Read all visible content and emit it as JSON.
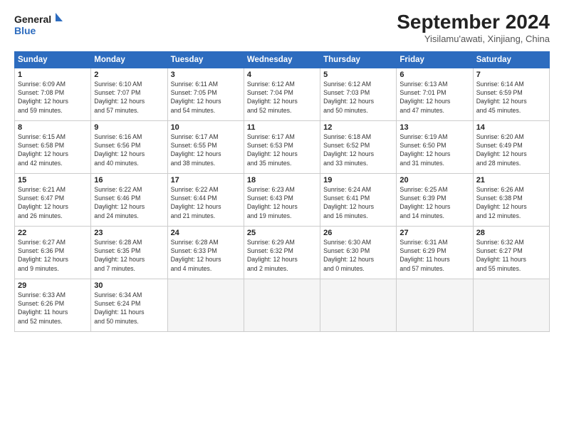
{
  "logo": {
    "line1": "General",
    "line2": "Blue"
  },
  "title": "September 2024",
  "location": "Yisilamu'awati, Xinjiang, China",
  "days_of_week": [
    "Sunday",
    "Monday",
    "Tuesday",
    "Wednesday",
    "Thursday",
    "Friday",
    "Saturday"
  ],
  "weeks": [
    [
      {
        "day": "1",
        "info": "Sunrise: 6:09 AM\nSunset: 7:08 PM\nDaylight: 12 hours\nand 59 minutes."
      },
      {
        "day": "2",
        "info": "Sunrise: 6:10 AM\nSunset: 7:07 PM\nDaylight: 12 hours\nand 57 minutes."
      },
      {
        "day": "3",
        "info": "Sunrise: 6:11 AM\nSunset: 7:05 PM\nDaylight: 12 hours\nand 54 minutes."
      },
      {
        "day": "4",
        "info": "Sunrise: 6:12 AM\nSunset: 7:04 PM\nDaylight: 12 hours\nand 52 minutes."
      },
      {
        "day": "5",
        "info": "Sunrise: 6:12 AM\nSunset: 7:03 PM\nDaylight: 12 hours\nand 50 minutes."
      },
      {
        "day": "6",
        "info": "Sunrise: 6:13 AM\nSunset: 7:01 PM\nDaylight: 12 hours\nand 47 minutes."
      },
      {
        "day": "7",
        "info": "Sunrise: 6:14 AM\nSunset: 6:59 PM\nDaylight: 12 hours\nand 45 minutes."
      }
    ],
    [
      {
        "day": "8",
        "info": "Sunrise: 6:15 AM\nSunset: 6:58 PM\nDaylight: 12 hours\nand 42 minutes."
      },
      {
        "day": "9",
        "info": "Sunrise: 6:16 AM\nSunset: 6:56 PM\nDaylight: 12 hours\nand 40 minutes."
      },
      {
        "day": "10",
        "info": "Sunrise: 6:17 AM\nSunset: 6:55 PM\nDaylight: 12 hours\nand 38 minutes."
      },
      {
        "day": "11",
        "info": "Sunrise: 6:17 AM\nSunset: 6:53 PM\nDaylight: 12 hours\nand 35 minutes."
      },
      {
        "day": "12",
        "info": "Sunrise: 6:18 AM\nSunset: 6:52 PM\nDaylight: 12 hours\nand 33 minutes."
      },
      {
        "day": "13",
        "info": "Sunrise: 6:19 AM\nSunset: 6:50 PM\nDaylight: 12 hours\nand 31 minutes."
      },
      {
        "day": "14",
        "info": "Sunrise: 6:20 AM\nSunset: 6:49 PM\nDaylight: 12 hours\nand 28 minutes."
      }
    ],
    [
      {
        "day": "15",
        "info": "Sunrise: 6:21 AM\nSunset: 6:47 PM\nDaylight: 12 hours\nand 26 minutes."
      },
      {
        "day": "16",
        "info": "Sunrise: 6:22 AM\nSunset: 6:46 PM\nDaylight: 12 hours\nand 24 minutes."
      },
      {
        "day": "17",
        "info": "Sunrise: 6:22 AM\nSunset: 6:44 PM\nDaylight: 12 hours\nand 21 minutes."
      },
      {
        "day": "18",
        "info": "Sunrise: 6:23 AM\nSunset: 6:43 PM\nDaylight: 12 hours\nand 19 minutes."
      },
      {
        "day": "19",
        "info": "Sunrise: 6:24 AM\nSunset: 6:41 PM\nDaylight: 12 hours\nand 16 minutes."
      },
      {
        "day": "20",
        "info": "Sunrise: 6:25 AM\nSunset: 6:39 PM\nDaylight: 12 hours\nand 14 minutes."
      },
      {
        "day": "21",
        "info": "Sunrise: 6:26 AM\nSunset: 6:38 PM\nDaylight: 12 hours\nand 12 minutes."
      }
    ],
    [
      {
        "day": "22",
        "info": "Sunrise: 6:27 AM\nSunset: 6:36 PM\nDaylight: 12 hours\nand 9 minutes."
      },
      {
        "day": "23",
        "info": "Sunrise: 6:28 AM\nSunset: 6:35 PM\nDaylight: 12 hours\nand 7 minutes."
      },
      {
        "day": "24",
        "info": "Sunrise: 6:28 AM\nSunset: 6:33 PM\nDaylight: 12 hours\nand 4 minutes."
      },
      {
        "day": "25",
        "info": "Sunrise: 6:29 AM\nSunset: 6:32 PM\nDaylight: 12 hours\nand 2 minutes."
      },
      {
        "day": "26",
        "info": "Sunrise: 6:30 AM\nSunset: 6:30 PM\nDaylight: 12 hours\nand 0 minutes."
      },
      {
        "day": "27",
        "info": "Sunrise: 6:31 AM\nSunset: 6:29 PM\nDaylight: 11 hours\nand 57 minutes."
      },
      {
        "day": "28",
        "info": "Sunrise: 6:32 AM\nSunset: 6:27 PM\nDaylight: 11 hours\nand 55 minutes."
      }
    ],
    [
      {
        "day": "29",
        "info": "Sunrise: 6:33 AM\nSunset: 6:26 PM\nDaylight: 11 hours\nand 52 minutes."
      },
      {
        "day": "30",
        "info": "Sunrise: 6:34 AM\nSunset: 6:24 PM\nDaylight: 11 hours\nand 50 minutes."
      },
      {
        "day": "",
        "info": ""
      },
      {
        "day": "",
        "info": ""
      },
      {
        "day": "",
        "info": ""
      },
      {
        "day": "",
        "info": ""
      },
      {
        "day": "",
        "info": ""
      }
    ]
  ]
}
